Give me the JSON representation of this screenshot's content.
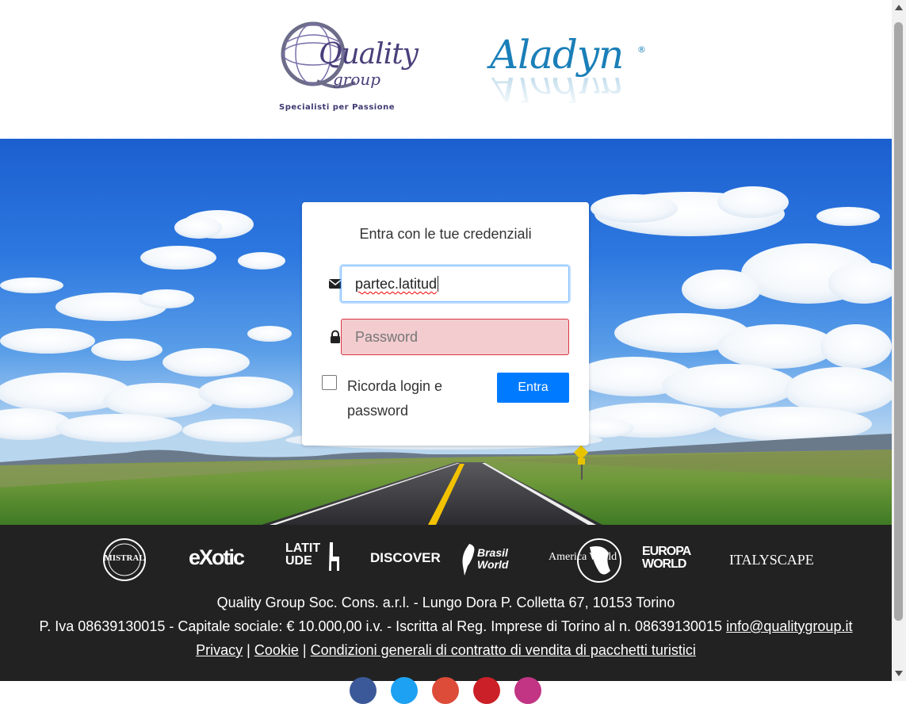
{
  "header": {
    "logo_quality": {
      "line1": "Quality",
      "line2": "group",
      "tagline": "Specialisti per Passione"
    },
    "logo_aladyn": {
      "name": "Aladyn",
      "mark": "®"
    }
  },
  "login": {
    "title": "Entra con le tue credenziali",
    "username_value": "partec.latitud",
    "password_placeholder": "Password",
    "remember_label": "Ricorda login e password",
    "submit_label": "Entra",
    "remember_checked": false
  },
  "footer": {
    "brands": [
      "MISTRAL",
      "eXotic",
      "LATITUDE",
      "DISCOVER",
      "Brasil World",
      "America World",
      "EUROPA WORLD",
      "ITALYSCAPE"
    ],
    "address": "Quality Group Soc. Cons. a.r.l. - Lungo Dora P. Colletta 67, 10153 Torino",
    "fiscal": "P. Iva 08639130015 - Capitale sociale: € 10.000,00 i.v. - Iscritta al Reg. Imprese di Torino al n. 08639130015",
    "email": "info@qualitygroup.it",
    "links": {
      "privacy": "Privacy",
      "cookie": "Cookie",
      "conditions": "Condizioni generali di contratto di vendita di pacchetti turistici"
    },
    "separator": "|"
  },
  "colors": {
    "primary": "#007bff",
    "footer_bg": "#222222",
    "invalid_bg": "#f2cccf",
    "invalid_border": "#dc3545"
  }
}
